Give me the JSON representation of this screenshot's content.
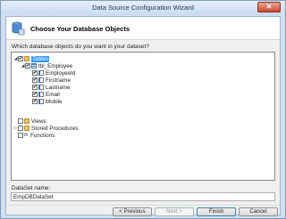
{
  "window": {
    "title": "Data Source Configuration Wizard",
    "close_glyph": "✕"
  },
  "header": {
    "title": "Choose Your Database Objects"
  },
  "prompt": "Which database objects do you want in your dataset?",
  "tree": {
    "tables": {
      "label": "Tables",
      "checked": true,
      "arrow": "◢"
    },
    "table": {
      "label": "tbl_Employee",
      "checked": true,
      "arrow": "◢"
    },
    "columns": [
      "EmployeeId",
      "Firstname",
      "Lastname",
      "Email",
      "Mobile"
    ],
    "views": {
      "label": "Views",
      "checked": false
    },
    "procs": {
      "label": "Stored Procedures",
      "checked": false,
      "arrow": "▷"
    },
    "functions": {
      "label": "Functions",
      "checked": false,
      "icon": "fx"
    }
  },
  "dataset": {
    "label": "DataSet name:",
    "value": "EmpDBDataSet"
  },
  "buttons": {
    "previous": "< Previous",
    "next": "Next >",
    "finish": "Finish",
    "cancel": "Cancel"
  },
  "check_glyph": "✔"
}
